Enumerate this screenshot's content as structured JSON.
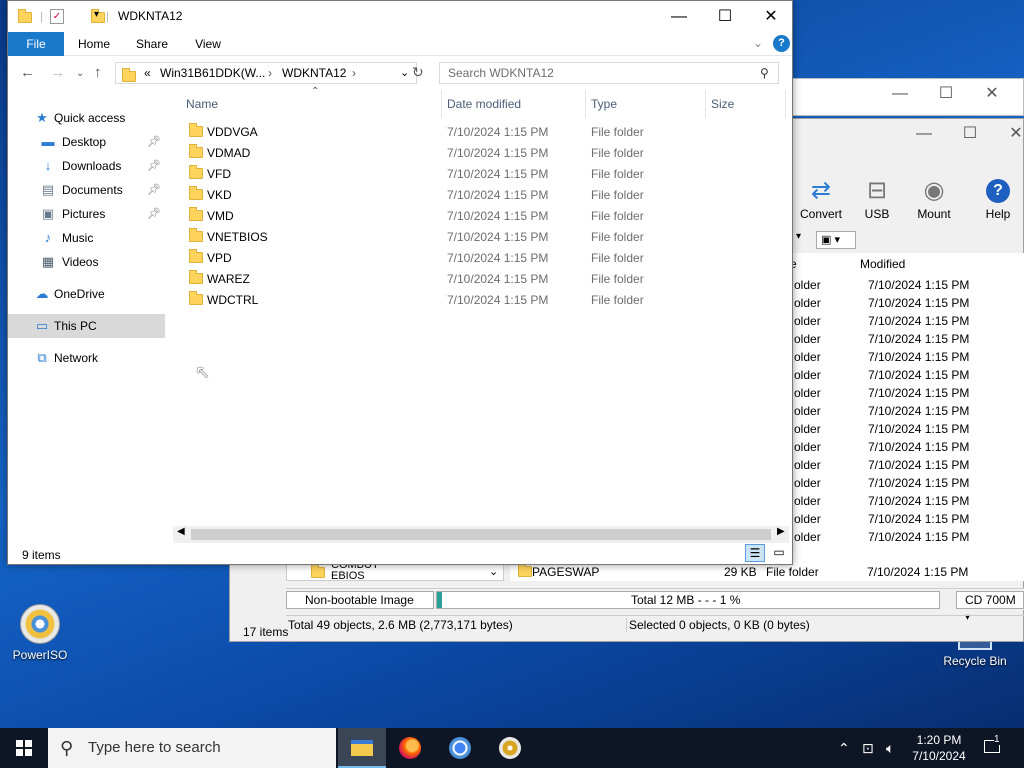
{
  "desktop": {
    "icons": [
      {
        "label": "PowerISO"
      },
      {
        "label": "Recycle Bin"
      }
    ]
  },
  "poweriso": {
    "toolbar": [
      {
        "label": "Convert",
        "glyph": "⇄"
      },
      {
        "label": "USB",
        "glyph": "⊟"
      },
      {
        "label": "Mount",
        "glyph": "◉"
      },
      {
        "label": "Help",
        "glyph": "?"
      }
    ],
    "column_modified": "Modified",
    "rows": [
      {
        "type": "older",
        "modified": "7/10/2024 1:15 PM"
      },
      {
        "type": "older",
        "modified": "7/10/2024 1:15 PM"
      },
      {
        "type": "older",
        "modified": "7/10/2024 1:15 PM"
      },
      {
        "type": "older",
        "modified": "7/10/2024 1:15 PM"
      },
      {
        "type": "older",
        "modified": "7/10/2024 1:15 PM"
      },
      {
        "type": "older",
        "modified": "7/10/2024 1:15 PM"
      },
      {
        "type": "older",
        "modified": "7/10/2024 1:15 PM"
      },
      {
        "type": "older",
        "modified": "7/10/2024 1:15 PM"
      },
      {
        "type": "older",
        "modified": "7/10/2024 1:15 PM"
      },
      {
        "type": "older",
        "modified": "7/10/2024 1:15 PM"
      },
      {
        "type": "older",
        "modified": "7/10/2024 1:15 PM"
      },
      {
        "type": "older",
        "modified": "7/10/2024 1:15 PM"
      },
      {
        "type": "older",
        "modified": "7/10/2024 1:15 PM"
      },
      {
        "type": "older",
        "modified": "7/10/2024 1:15 PM"
      },
      {
        "type": "older",
        "modified": "7/10/2024 1:15 PM"
      }
    ],
    "last_row": {
      "left_name": "COMBUT\nEBIOS",
      "name": "PAGESWAP",
      "size": "29 KB",
      "type": "File folder",
      "modified": "7/10/2024 1:15 PM"
    },
    "image_type": "Non-bootable Image",
    "total_label": "Total  12 MB   - - -  1 %",
    "progress": 0.01,
    "media": "CD 700M",
    "left_status": "17 items",
    "status_total": "Total 49 objects, 2.6 MB (2,773,171 bytes)",
    "status_selected": "Selected 0 objects, 0 KB (0 bytes)"
  },
  "explorer": {
    "title": "WDKNTA12",
    "ribbon_tabs": [
      "File",
      "Home",
      "Share",
      "View"
    ],
    "breadcrumb": {
      "prefix": "«",
      "part1": "Win31B61DDK(W...",
      "part2": "WDKNTA12"
    },
    "search_placeholder": "Search WDKNTA12",
    "nav": [
      {
        "label": "Quick access",
        "glyph": "★",
        "color": "#2b7cd3"
      },
      {
        "label": "Desktop",
        "glyph": "▬",
        "color": "#2b7cd3",
        "pinned": true
      },
      {
        "label": "Downloads",
        "glyph": "↓",
        "color": "#2b7cd3",
        "pinned": true
      },
      {
        "label": "Documents",
        "glyph": "▤",
        "color": "#6b7b8c",
        "pinned": true
      },
      {
        "label": "Pictures",
        "glyph": "▣",
        "color": "#6b7b8c",
        "pinned": true
      },
      {
        "label": "Music",
        "glyph": "♪",
        "color": "#2b7cd3"
      },
      {
        "label": "Videos",
        "glyph": "▦",
        "color": "#4a5a6a"
      },
      {
        "label": "OneDrive",
        "glyph": "☁",
        "color": "#2b7cd3"
      },
      {
        "label": "This PC",
        "glyph": "▭",
        "color": "#2b7cd3"
      },
      {
        "label": "Network",
        "glyph": "⧉",
        "color": "#2b7cd3"
      }
    ],
    "columns": {
      "name": "Name",
      "date": "Date modified",
      "type": "Type",
      "size": "Size"
    },
    "files": [
      {
        "name": "VDDVGA",
        "date": "7/10/2024 1:15 PM",
        "type": "File folder"
      },
      {
        "name": "VDMAD",
        "date": "7/10/2024 1:15 PM",
        "type": "File folder"
      },
      {
        "name": "VFD",
        "date": "7/10/2024 1:15 PM",
        "type": "File folder"
      },
      {
        "name": "VKD",
        "date": "7/10/2024 1:15 PM",
        "type": "File folder"
      },
      {
        "name": "VMD",
        "date": "7/10/2024 1:15 PM",
        "type": "File folder"
      },
      {
        "name": "VNETBIOS",
        "date": "7/10/2024 1:15 PM",
        "type": "File folder"
      },
      {
        "name": "VPD",
        "date": "7/10/2024 1:15 PM",
        "type": "File folder"
      },
      {
        "name": "WAREZ",
        "date": "7/10/2024 1:15 PM",
        "type": "File folder"
      },
      {
        "name": "WDCTRL",
        "date": "7/10/2024 1:15 PM",
        "type": "File folder"
      }
    ],
    "status": "9 items"
  },
  "taskbar": {
    "search_placeholder": "Type here to search",
    "time": "1:20 PM",
    "date": "7/10/2024",
    "notification_count": "1",
    "colors": {
      "bg": "#0e1626",
      "accent": "#2b7cd3"
    }
  }
}
